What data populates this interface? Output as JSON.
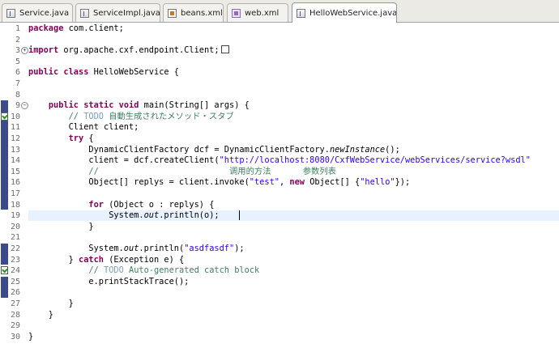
{
  "tabs": [
    {
      "label": "Service.java",
      "icon": "java-file-icon",
      "active": false
    },
    {
      "label": "ServiceImpl.java",
      "icon": "java-file-icon",
      "active": false
    },
    {
      "label": "beans.xml",
      "icon": "xml-file-icon",
      "active": false
    },
    {
      "label": "web.xml",
      "icon": "web-xml-file-icon",
      "active": false
    },
    {
      "label": "HelloWebService.java",
      "icon": "java-file-icon",
      "active": true
    }
  ],
  "close_glyph": "✕",
  "colors": {
    "keyword": "#7f0055",
    "string": "#2a00ff",
    "comment": "#3f7f5f",
    "todo": "#7f9fbf",
    "current_line": "#e8f2fe",
    "change_bar": "#3b4b8c"
  },
  "editor": {
    "current_line": 19,
    "lines": [
      {
        "n": "1",
        "tokens": [
          [
            "kw",
            "package"
          ],
          [
            "t",
            " com.client;"
          ]
        ]
      },
      {
        "n": "2",
        "tokens": []
      },
      {
        "n": "3",
        "fold": "+",
        "tokens": [
          [
            "kw",
            "import"
          ],
          [
            "t",
            " org.apache.cxf.endpoint.Client;"
          ]
        ],
        "folded": true
      },
      {
        "n": "5",
        "tokens": []
      },
      {
        "n": "6",
        "tokens": [
          [
            "kw",
            "public"
          ],
          [
            "t",
            " "
          ],
          [
            "kw",
            "class"
          ],
          [
            "t",
            " HelloWebService {"
          ]
        ]
      },
      {
        "n": "7",
        "tokens": []
      },
      {
        "n": "8",
        "tokens": []
      },
      {
        "n": "9",
        "fold": "−",
        "tokens": [
          [
            "t",
            "    "
          ],
          [
            "kw",
            "public"
          ],
          [
            "t",
            " "
          ],
          [
            "kw",
            "static"
          ],
          [
            "t",
            " "
          ],
          [
            "kw",
            "void"
          ],
          [
            "t",
            " main(String[] args) {"
          ]
        ]
      },
      {
        "n": "10",
        "task": true,
        "tokens": [
          [
            "cm",
            "        // "
          ],
          [
            "todo",
            "TODO"
          ],
          [
            "cm",
            " "
          ],
          [
            "cmj",
            "自動生成されたメソッド・スタブ"
          ]
        ]
      },
      {
        "n": "11",
        "tokens": [
          [
            "t",
            "        Client client;"
          ]
        ]
      },
      {
        "n": "12",
        "tokens": [
          [
            "t",
            "        "
          ],
          [
            "kw",
            "try"
          ],
          [
            "t",
            " {"
          ]
        ]
      },
      {
        "n": "13",
        "tokens": [
          [
            "t",
            "            DynamicClientFactory dcf = DynamicClientFactory."
          ],
          [
            "it",
            "newInstance"
          ],
          [
            "t",
            "();"
          ]
        ]
      },
      {
        "n": "14",
        "tokens": [
          [
            "t",
            "            client = dcf.createClient("
          ],
          [
            "str",
            "\"http://localhost:8080/CxfWebService/webServices/service?wsdl\""
          ]
        ]
      },
      {
        "n": "15",
        "tokens": [
          [
            "cm",
            "            //                          "
          ],
          [
            "cmj",
            "调用的方法            参数列表"
          ]
        ]
      },
      {
        "n": "16",
        "tokens": [
          [
            "t",
            "            Object[] replys = client.invoke("
          ],
          [
            "str",
            "\"test\""
          ],
          [
            "t",
            ", "
          ],
          [
            "kw",
            "new"
          ],
          [
            "t",
            " Object[] {"
          ],
          [
            "str",
            "\"hello\""
          ],
          [
            "t",
            "});"
          ]
        ]
      },
      {
        "n": "17",
        "tokens": []
      },
      {
        "n": "18",
        "tokens": [
          [
            "t",
            "            "
          ],
          [
            "kw",
            "for"
          ],
          [
            "t",
            " (Object o : replys) {"
          ]
        ]
      },
      {
        "n": "19",
        "tokens": [
          [
            "t",
            "                System."
          ],
          [
            "it",
            "out"
          ],
          [
            "t",
            ".println(o);"
          ]
        ]
      },
      {
        "n": "20",
        "tokens": [
          [
            "t",
            "            }"
          ]
        ]
      },
      {
        "n": "21",
        "tokens": []
      },
      {
        "n": "22",
        "tokens": [
          [
            "t",
            "            System."
          ],
          [
            "it",
            "out"
          ],
          [
            "t",
            ".println("
          ],
          [
            "str",
            "\"asdfasdf\""
          ],
          [
            "t",
            ");"
          ]
        ]
      },
      {
        "n": "23",
        "tokens": [
          [
            "t",
            "        } "
          ],
          [
            "kw",
            "catch"
          ],
          [
            "t",
            " (Exception e) {"
          ]
        ]
      },
      {
        "n": "24",
        "task": true,
        "tokens": [
          [
            "cm",
            "            // "
          ],
          [
            "todo",
            "TODO"
          ],
          [
            "cm",
            " Auto-generated catch block"
          ]
        ]
      },
      {
        "n": "25",
        "tokens": [
          [
            "t",
            "            e.printStackTrace();"
          ]
        ]
      },
      {
        "n": "26",
        "tokens": []
      },
      {
        "n": "27",
        "tokens": [
          [
            "t",
            "        }"
          ]
        ]
      },
      {
        "n": "28",
        "tokens": [
          [
            "t",
            "    }"
          ]
        ]
      },
      {
        "n": "29",
        "tokens": []
      },
      {
        "n": "30",
        "tokens": [
          [
            "t",
            "}"
          ]
        ]
      }
    ]
  }
}
